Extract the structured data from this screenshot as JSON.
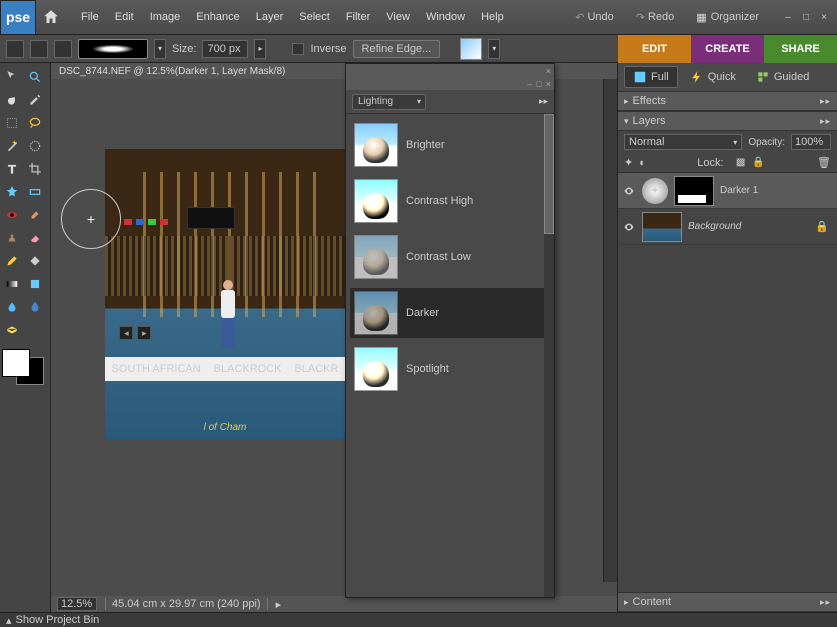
{
  "menu": [
    "File",
    "Edit",
    "Image",
    "Enhance",
    "Layer",
    "Select",
    "Filter",
    "View",
    "Window",
    "Help"
  ],
  "undo": "Undo",
  "redo": "Redo",
  "organizer": "Organizer",
  "opt": {
    "size_lbl": "Size:",
    "size_val": "700 px",
    "inverse": "Inverse",
    "refine": "Refine Edge..."
  },
  "modes": {
    "edit": "EDIT",
    "create": "CREATE",
    "share": "SHARE"
  },
  "doc": {
    "title": "DSC_8744.NEF @ 12.5%(Darker 1, Layer Mask/8)",
    "zoom": "12.5%",
    "status": "45.04 cm x 29.97 cm (240 ppi)"
  },
  "img": {
    "board1": "SOUTH AFRICAN",
    "board2": "BLACKROCK",
    "board3": "BLACKR",
    "floor": "l  of  Cham"
  },
  "fx": {
    "category": "Lighting",
    "items": [
      "Brighter",
      "Contrast High",
      "Contrast Low",
      "Darker",
      "Spotlight"
    ]
  },
  "view": {
    "full": "Full",
    "quick": "Quick",
    "guided": "Guided"
  },
  "panels": {
    "effects": "Effects",
    "layers": "Layers",
    "content": "Content"
  },
  "layers": {
    "blend": "Normal",
    "opac_lbl": "Opacity:",
    "opac_val": "100%",
    "lock_lbl": "Lock:",
    "l1": "Darker 1",
    "l2": "Background"
  },
  "projbin": "Show Project Bin"
}
